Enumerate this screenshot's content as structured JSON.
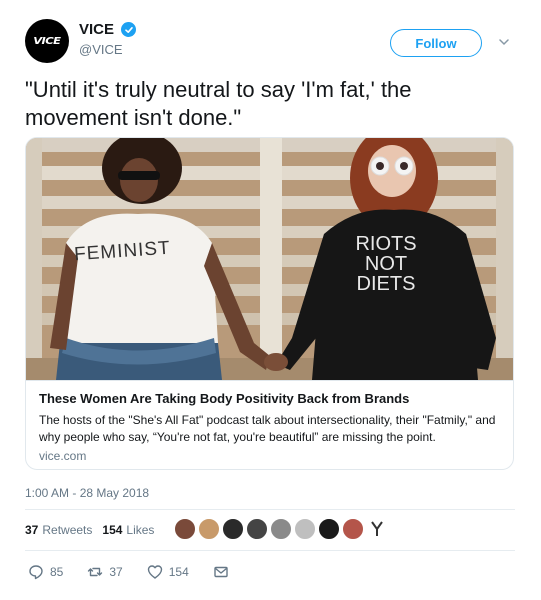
{
  "account": {
    "logo_text": "VICE",
    "display_name": "VICE",
    "handle": "@VICE",
    "verified_icon": "verified-badge-icon",
    "follow_label": "Follow",
    "menu_icon": "chevron-down-icon"
  },
  "tweet": {
    "text": "\"Until it's truly neutral to say 'I'm fat,' the movement isn't done.\"",
    "timestamp": "1:00 AM - 28 May 2018"
  },
  "card": {
    "image": {
      "left_shirt_text": "FEMINIST",
      "right_shirt_lines": [
        "RIOTS",
        "NOT",
        "DIETS"
      ]
    },
    "title": "These Women Are Taking Body Positivity Back from Brands",
    "description": "The hosts of the \"She's All Fat\" podcast talk about intersectionality, their \"Fatmily,\" and why people who say, “You're not fat, you're beautiful” are missing the point.",
    "domain": "vice.com"
  },
  "stats": {
    "retweets_count": "37",
    "retweets_label": "Retweets",
    "likes_count": "154",
    "likes_label": "Likes"
  },
  "actions": {
    "reply_count": "85",
    "retweet_count": "37",
    "like_count": "154",
    "reply_icon": "reply-icon",
    "retweet_icon": "retweet-icon",
    "like_icon": "heart-icon",
    "dm_icon": "envelope-icon"
  },
  "colors": {
    "accent": "#1da1f2",
    "text": "#14171a",
    "muted": "#657786",
    "border": "#e1e8ed"
  }
}
